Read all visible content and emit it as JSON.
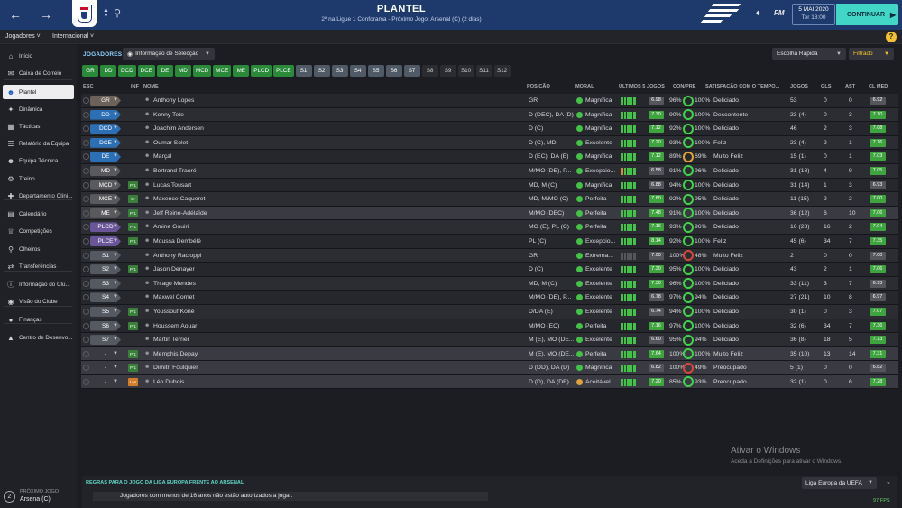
{
  "header": {
    "back_icon": "arrow-left-icon",
    "forward_icon": "arrow-right-icon",
    "title": "PLANTEL",
    "subtitle": "2ª na Ligue 1 Conforama - Próximo Jogo: Arsenal (C) (2 dias)",
    "date": "5 MAI 2020",
    "time": "Ter 18:00",
    "continue_label": "CONTINUAR",
    "fm_label": "FM"
  },
  "subnav": {
    "tab1": "Jogadores",
    "tab2": "Internacional",
    "help": "?"
  },
  "sidebar": {
    "items": [
      {
        "label": "Início"
      },
      {
        "label": "Caixa de Correio"
      },
      {
        "label": "Plantel"
      },
      {
        "label": "Dinâmica"
      },
      {
        "label": "Tácticas"
      },
      {
        "label": "Relatório da Equipa"
      },
      {
        "label": "Equipa Técnica"
      },
      {
        "label": "Treino"
      },
      {
        "label": "Departamento Clíni..."
      },
      {
        "label": "Calendário"
      },
      {
        "label": "Competições"
      },
      {
        "label": "Olheiros"
      },
      {
        "label": "Transferências"
      },
      {
        "label": "Informação do Clu..."
      },
      {
        "label": "Visão do Clube"
      },
      {
        "label": "Finanças"
      },
      {
        "label": "Centro de Desenvo..."
      }
    ],
    "next_game_label": "PRÓXIMO JOGO",
    "next_game_team": "Arsena (C)",
    "next_game_num": "2"
  },
  "toolbar": {
    "section_label": "JOGADORES",
    "view_dropdown": "Informação de Selecção",
    "quick_pick": "Escolha Rápida",
    "filter": "Filtrado"
  },
  "chips": [
    {
      "label": "GR",
      "state": "g"
    },
    {
      "label": "DD",
      "state": "g"
    },
    {
      "label": "DCD",
      "state": "g"
    },
    {
      "label": "DCE",
      "state": "g"
    },
    {
      "label": "DE",
      "state": "g"
    },
    {
      "label": "MD",
      "state": "g"
    },
    {
      "label": "MCD",
      "state": "g"
    },
    {
      "label": "MCE",
      "state": "g"
    },
    {
      "label": "ME",
      "state": "g"
    },
    {
      "label": "PLCD",
      "state": "g"
    },
    {
      "label": "PLCE",
      "state": "g"
    },
    {
      "label": "S1",
      "state": "s"
    },
    {
      "label": "S2",
      "state": "s"
    },
    {
      "label": "S3",
      "state": "s"
    },
    {
      "label": "S4",
      "state": "s"
    },
    {
      "label": "S5",
      "state": "s"
    },
    {
      "label": "S6",
      "state": "s"
    },
    {
      "label": "S7",
      "state": "s"
    },
    {
      "label": "S8",
      "state": "n"
    },
    {
      "label": "S9",
      "state": "n"
    },
    {
      "label": "S10",
      "state": "n"
    },
    {
      "label": "S11",
      "state": "n"
    },
    {
      "label": "S12",
      "state": "n"
    }
  ],
  "columns": {
    "esc": "ESC",
    "inf": "INF",
    "nome": "NOME",
    "posicao": "POSIÇÃO",
    "moral": "MORAL",
    "ultimos": "ÚLTIMOS 5 JOGOS",
    "conpre": "CON/PRE",
    "satisfacao": "SATISFAÇÃO COM O TEMPO...",
    "jogos": "JOGOS",
    "gls": "GLS",
    "ast": "AST",
    "clmed": "CL MED"
  },
  "colors": {
    "gk": "#6d6259",
    "def": "#2d6fb5",
    "mid": "#5a5a5e",
    "att": "#6a5599",
    "sub": "#555a62",
    "none": "#3a3b41",
    "green_rating": "#3fa33f",
    "grey_rating": "#55565c"
  },
  "players": [
    {
      "slot": "GR",
      "pc": "gk",
      "inf": "",
      "name": "Anthony Lopes",
      "pos": "GR",
      "moral": "Magnífica",
      "mc": "#43c248",
      "form": [
        "g",
        "g",
        "g",
        "g",
        "g"
      ],
      "frat": "6.98",
      "frc": "grey_rating",
      "con": "96%",
      "pre": "100%",
      "ring2": "#43d24b",
      "sat": "Deliciado",
      "jogos": "53",
      "gls": "0",
      "ast": "0",
      "cl": "6.92",
      "clc": "grey_rating"
    },
    {
      "slot": "DD",
      "pc": "def",
      "inf": "",
      "name": "Kenny Tete",
      "pos": "D (DEC), DA (D)",
      "moral": "Magnífica",
      "mc": "#43c248",
      "form": [
        "g",
        "g",
        "g",
        "g",
        "g"
      ],
      "frat": "7.30",
      "frc": "green_rating",
      "con": "90%",
      "pre": "100%",
      "ring2": "#43d24b",
      "sat": "Descontente",
      "jogos": "23 (4)",
      "gls": "0",
      "ast": "3",
      "cl": "7.10",
      "clc": "green_rating"
    },
    {
      "slot": "DCD",
      "pc": "def",
      "inf": "",
      "name": "Joachim Andersen",
      "pos": "D (C)",
      "moral": "Magnífica",
      "mc": "#43c248",
      "form": [
        "g",
        "g",
        "g",
        "g",
        "g"
      ],
      "frat": "7.12",
      "frc": "green_rating",
      "con": "92%",
      "pre": "100%",
      "ring2": "#43d24b",
      "sat": "Deliciado",
      "jogos": "46",
      "gls": "2",
      "ast": "3",
      "cl": "7.08",
      "clc": "green_rating"
    },
    {
      "slot": "DCE",
      "pc": "def",
      "inf": "",
      "name": "Oumar Solet",
      "pos": "D (C), MD",
      "moral": "Excelente",
      "mc": "#43c248",
      "form": [
        "g",
        "g",
        "g",
        "g",
        "g"
      ],
      "frat": "7.20",
      "frc": "green_rating",
      "con": "93%",
      "pre": "100%",
      "ring2": "#43d24b",
      "sat": "Feliz",
      "jogos": "23 (4)",
      "gls": "2",
      "ast": "1",
      "cl": "7.16",
      "clc": "green_rating"
    },
    {
      "slot": "DE",
      "pc": "def",
      "inf": "",
      "name": "Marçal",
      "pos": "D (EC), DA (E)",
      "moral": "Magnífica",
      "mc": "#43c248",
      "form": [
        "g",
        "g",
        "g",
        "g",
        "g"
      ],
      "frat": "7.12",
      "frc": "green_rating",
      "con": "89%",
      "pre": "69%",
      "ring2": "#e0a23a",
      "sat": "Muito Feliz",
      "jogos": "15 (1)",
      "gls": "0",
      "ast": "1",
      "cl": "7.03",
      "clc": "green_rating"
    },
    {
      "slot": "MD",
      "pc": "mid",
      "inf": "",
      "name": "Bertrand Traoré",
      "pos": "M/MO (DE), P...",
      "moral": "Excepcio...",
      "mc": "#43c248",
      "form": [
        "o",
        "g",
        "g",
        "g",
        "g"
      ],
      "frat": "6.58",
      "frc": "grey_rating",
      "con": "91%",
      "pre": "96%",
      "ring2": "#43d24b",
      "sat": "Deliciado",
      "jogos": "31 (18)",
      "gls": "4",
      "ast": "9",
      "cl": "7.05",
      "clc": "green_rating"
    },
    {
      "slot": "MCD",
      "pc": "mid",
      "inf": "Pr1",
      "infc": "g",
      "name": "Lucas Tousart",
      "pos": "MD, M (C)",
      "moral": "Magnífica",
      "mc": "#43c248",
      "form": [
        "g",
        "g",
        "g",
        "g",
        "g"
      ],
      "frat": "6.88",
      "frc": "grey_rating",
      "con": "94%",
      "pre": "100%",
      "ring2": "#43d24b",
      "sat": "Deliciado",
      "jogos": "31 (14)",
      "gls": "1",
      "ast": "3",
      "cl": "6.93",
      "clc": "grey_rating"
    },
    {
      "slot": "MCE",
      "pc": "mid",
      "inf": "Br",
      "infc": "g",
      "name": "Maxence Caqueret",
      "pos": "MD, M/MO (C)",
      "moral": "Perfeita",
      "mc": "#43c248",
      "form": [
        "g",
        "g",
        "g",
        "g",
        "g"
      ],
      "frat": "7.80",
      "frc": "green_rating",
      "con": "92%",
      "pre": "95%",
      "ring2": "#43d24b",
      "sat": "Deliciado",
      "jogos": "11 (15)",
      "gls": "2",
      "ast": "2",
      "cl": "7.00",
      "clc": "green_rating"
    },
    {
      "slot": "ME",
      "pc": "mid",
      "inf": "Pr1",
      "infc": "g",
      "name": "Jeff Reine-Adélaïde",
      "pos": "M/MO (DEC)",
      "moral": "Perfeita",
      "mc": "#43c248",
      "form": [
        "g",
        "g",
        "g",
        "g",
        "g"
      ],
      "frat": "7.48",
      "frc": "green_rating",
      "con": "91%",
      "pre": "100%",
      "ring2": "#43d24b",
      "sat": "Deliciado",
      "jogos": "36 (12)",
      "gls": "6",
      "ast": "10",
      "cl": "7.06",
      "clc": "green_rating",
      "selected": true
    },
    {
      "slot": "PLCD",
      "pc": "att",
      "inf": "Pr1",
      "infc": "g",
      "name": "Amine Gouiri",
      "pos": "MO (E), PL (C)",
      "moral": "Perfeita",
      "mc": "#43c248",
      "form": [
        "g",
        "g",
        "g",
        "g",
        "g"
      ],
      "frat": "7.16",
      "frc": "green_rating",
      "con": "93%",
      "pre": "96%",
      "ring2": "#43d24b",
      "sat": "Deliciado",
      "jogos": "16 (28)",
      "gls": "16",
      "ast": "2",
      "cl": "7.04",
      "clc": "green_rating"
    },
    {
      "slot": "PLCE",
      "pc": "att",
      "inf": "Pr1",
      "infc": "g",
      "name": "Moussa Dembélé",
      "pos": "PL (C)",
      "moral": "Excepcio...",
      "mc": "#43c248",
      "form": [
        "g",
        "g",
        "g",
        "g",
        "g"
      ],
      "frat": "8.14",
      "frc": "green_rating",
      "con": "92%",
      "pre": "100%",
      "ring2": "#43d24b",
      "sat": "Feliz",
      "jogos": "45 (6)",
      "gls": "34",
      "ast": "7",
      "cl": "7.35",
      "clc": "green_rating"
    },
    {
      "slot": "S1",
      "pc": "sub",
      "inf": "",
      "name": "Anthony Racioppi",
      "pos": "GR",
      "moral": "Extrema...",
      "mc": "#43c248",
      "form": [
        "n",
        "n",
        "n",
        "n",
        "n"
      ],
      "frat": "7.00",
      "frc": "grey_rating",
      "con": "100%",
      "pre": "48%",
      "ring2": "#d9463a",
      "sat": "Muito Feliz",
      "jogos": "2",
      "gls": "0",
      "ast": "0",
      "cl": "7.00",
      "clc": "grey_rating"
    },
    {
      "slot": "S2",
      "pc": "sub",
      "inf": "Pr1",
      "infc": "g",
      "name": "Jason Denayer",
      "pos": "D (C)",
      "moral": "Excelente",
      "mc": "#43c248",
      "form": [
        "g",
        "g",
        "g",
        "g",
        "g"
      ],
      "frat": "7.30",
      "frc": "green_rating",
      "con": "95%",
      "pre": "100%",
      "ring2": "#43d24b",
      "sat": "Deliciado",
      "jogos": "43",
      "gls": "2",
      "ast": "1",
      "cl": "7.06",
      "clc": "green_rating"
    },
    {
      "slot": "S3",
      "pc": "sub",
      "inf": "",
      "name": "Thiago Mendes",
      "pos": "MD, M (C)",
      "moral": "Excelente",
      "mc": "#43c248",
      "form": [
        "g",
        "g",
        "g",
        "g",
        "g"
      ],
      "frat": "7.30",
      "frc": "green_rating",
      "con": "96%",
      "pre": "100%",
      "ring2": "#43d24b",
      "sat": "Deliciado",
      "jogos": "33 (11)",
      "gls": "3",
      "ast": "7",
      "cl": "6.93",
      "clc": "grey_rating"
    },
    {
      "slot": "S4",
      "pc": "sub",
      "inf": "",
      "name": "Maxwel Cornet",
      "pos": "M/MO (DE), P...",
      "moral": "Excelente",
      "mc": "#43c248",
      "form": [
        "g",
        "g",
        "g",
        "g",
        "g"
      ],
      "frat": "6.78",
      "frc": "grey_rating",
      "con": "97%",
      "pre": "94%",
      "ring2": "#43d24b",
      "sat": "Deliciado",
      "jogos": "27 (21)",
      "gls": "10",
      "ast": "8",
      "cl": "6.97",
      "clc": "grey_rating"
    },
    {
      "slot": "S5",
      "pc": "sub",
      "inf": "Pr1",
      "infc": "g",
      "name": "Youssouf Koné",
      "pos": "D/DA (E)",
      "moral": "Excelente",
      "mc": "#43c248",
      "form": [
        "g",
        "g",
        "g",
        "g",
        "g"
      ],
      "frat": "6.74",
      "frc": "grey_rating",
      "con": "94%",
      "pre": "100%",
      "ring2": "#43d24b",
      "sat": "Deliciado",
      "jogos": "30 (1)",
      "gls": "0",
      "ast": "3",
      "cl": "7.07",
      "clc": "green_rating"
    },
    {
      "slot": "S6",
      "pc": "sub",
      "inf": "Pr1",
      "infc": "g",
      "name": "Houssem Aouar",
      "pos": "M/MO (EC)",
      "moral": "Perfeita",
      "mc": "#43c248",
      "form": [
        "g",
        "g",
        "g",
        "g",
        "g"
      ],
      "frat": "7.16",
      "frc": "green_rating",
      "con": "97%",
      "pre": "100%",
      "ring2": "#43d24b",
      "sat": "Deliciado",
      "jogos": "32 (6)",
      "gls": "34",
      "ast": "7",
      "cl": "7.36",
      "clc": "green_rating"
    },
    {
      "slot": "S7",
      "pc": "sub",
      "inf": "",
      "name": "Martin Terrier",
      "pos": "M (E), MO (DE...",
      "moral": "Excelente",
      "mc": "#43c248",
      "form": [
        "g",
        "g",
        "g",
        "g",
        "g"
      ],
      "frat": "6.60",
      "frc": "grey_rating",
      "con": "95%",
      "pre": "94%",
      "ring2": "#43d24b",
      "sat": "Deliciado",
      "jogos": "36 (8)",
      "gls": "18",
      "ast": "5",
      "cl": "7.13",
      "clc": "green_rating"
    },
    {
      "slot": "-",
      "pc": "none",
      "inf": "Pr1",
      "infc": "g",
      "name": "Memphis Depay",
      "pos": "M (E), MO (DE...",
      "moral": "Perfeita",
      "mc": "#43c248",
      "form": [
        "g",
        "g",
        "g",
        "g",
        "g"
      ],
      "frat": "7.64",
      "frc": "green_rating",
      "con": "100%",
      "pre": "100%",
      "ring2": "#43d24b",
      "sat": "Muito Feliz",
      "jogos": "35 (10)",
      "gls": "13",
      "ast": "14",
      "cl": "7.31",
      "clc": "green_rating",
      "selected": true
    },
    {
      "slot": "-",
      "pc": "none",
      "inf": "Pr1",
      "infc": "g",
      "name": "Dimitri Foulquier",
      "pos": "D (DD), DA (D)",
      "moral": "Magnífica",
      "mc": "#43c248",
      "form": [
        "g",
        "g",
        "g",
        "g",
        "g"
      ],
      "frat": "6.82",
      "frc": "grey_rating",
      "con": "100%",
      "pre": "49%",
      "ring2": "#d9463a",
      "sat": "Preocupado",
      "jogos": "5 (1)",
      "gls": "0",
      "ast": "0",
      "cl": "6.82",
      "clc": "grey_rating",
      "selected": true
    },
    {
      "slot": "-",
      "pc": "none",
      "inf": "Les",
      "infc": "o",
      "name": "Léo Dubois",
      "pos": "D (D), DA (DE)",
      "moral": "Aceitável",
      "mc": "#e0a23a",
      "form": [
        "g",
        "g",
        "g",
        "g",
        "g"
      ],
      "frat": "7.20",
      "frc": "green_rating",
      "con": "85%",
      "pre": "93%",
      "ring2": "#43d24b",
      "sat": "Preocupado",
      "jogos": "32 (1)",
      "gls": "0",
      "ast": "6",
      "cl": "7.28",
      "clc": "green_rating",
      "selected": true
    }
  ],
  "watermark": {
    "line1": "Ativar o Windows",
    "line2": "Aceda a Definições para ativar o Windows."
  },
  "rules": {
    "title": "REGRAS PARA O JOGO DA LIGA EUROPA FRENTE AO ARSENAL",
    "message": "Jogadores com menos de 16 anos não estão autorizados a jogar.",
    "competition": "Liga Europa da UEFA"
  },
  "fps": "97 FPS"
}
